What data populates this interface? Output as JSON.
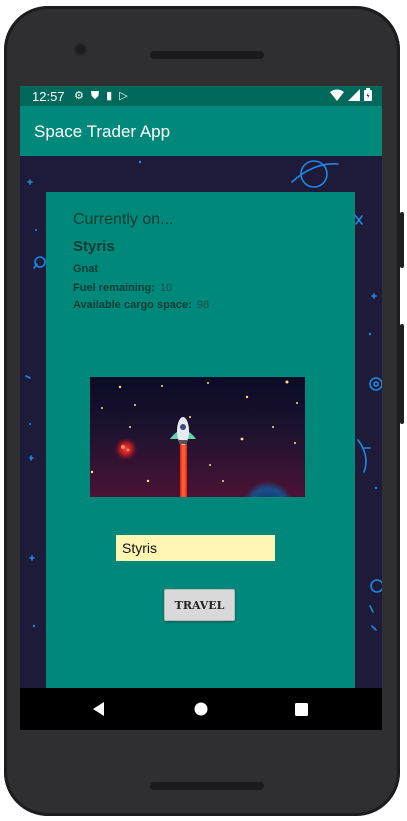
{
  "status_bar": {
    "time": "12:57",
    "left_icons": [
      "gear-icon",
      "shield-icon",
      "sd-card-icon",
      "play-store-icon"
    ],
    "right_icons": [
      "wifi-icon",
      "signal-icon",
      "battery-icon"
    ]
  },
  "app_bar": {
    "title": "Space Trader App"
  },
  "location": {
    "heading": "Currently on...",
    "planet": "Styris",
    "ship": "Gnat",
    "fuel_label": "Fuel remaining:",
    "fuel_value": "10",
    "cargo_label": "Available cargo space:",
    "cargo_value": "98"
  },
  "travel": {
    "destination_value": "Styris",
    "button_label": "TRAVEL"
  },
  "nav_bar": {
    "items": [
      "back-icon",
      "home-icon",
      "recents-icon"
    ]
  },
  "colors": {
    "status_bar": "#00695c",
    "app_bar": "#00897b",
    "panel": "#00897b",
    "background": "#1e1b3a",
    "input": "#fff6b3"
  }
}
